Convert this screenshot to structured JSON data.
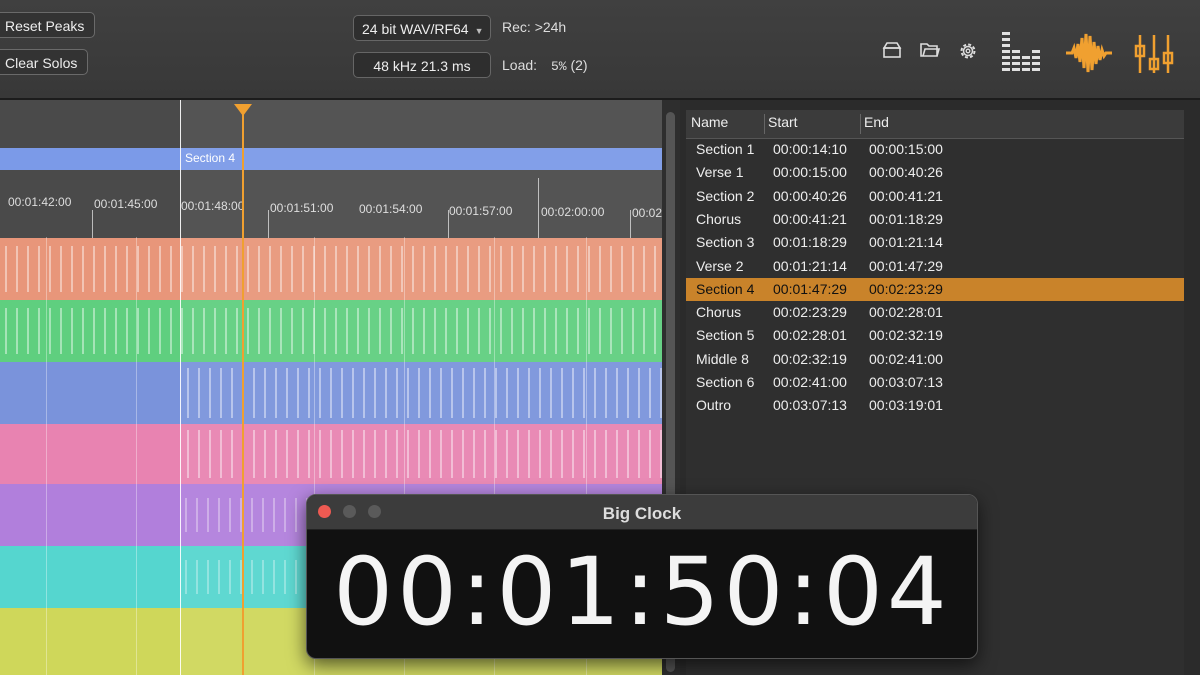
{
  "toolbar": {
    "reset_peaks": "Reset Peaks",
    "clear_solos": "Clear Solos",
    "format": "24 bit WAV/RF64",
    "rate": "48 kHz 21.3 ms",
    "rec_label": "Rec:",
    "rec_value": ">24h",
    "load_label": "Load:",
    "load_pct": "5%",
    "load_count": "(2)",
    "icons": [
      "eject-icon",
      "open-folder-icon",
      "settings-gear-icon",
      "meters-icon",
      "waveform-icon",
      "mixer-faders-icon"
    ]
  },
  "timeline": {
    "section_label": "Section 4",
    "ticks": [
      "00:01:42:00",
      "00:01:45:00",
      "00:01:48:00",
      "00:01:51:00",
      "00:01:54:00",
      "00:01:57:00",
      "00:02:00:00",
      "00:02"
    ],
    "track_colors": [
      "#e8967a",
      "#5fcf7f",
      "#7a93db",
      "#e883b1",
      "#b17fdc",
      "#55d6cf",
      "#cfd75a"
    ]
  },
  "markers": {
    "headers": {
      "name": "Name",
      "start": "Start",
      "end": "End"
    },
    "rows": [
      {
        "name": "Section 1",
        "start": "00:00:14:10",
        "end": "00:00:15:00"
      },
      {
        "name": "Verse 1",
        "start": "00:00:15:00",
        "end": "00:00:40:26"
      },
      {
        "name": "Section 2",
        "start": "00:00:40:26",
        "end": "00:00:41:21"
      },
      {
        "name": "Chorus",
        "start": "00:00:41:21",
        "end": "00:01:18:29"
      },
      {
        "name": "Section 3",
        "start": "00:01:18:29",
        "end": "00:01:21:14"
      },
      {
        "name": "Verse 2",
        "start": "00:01:21:14",
        "end": "00:01:47:29"
      },
      {
        "name": "Section 4",
        "start": "00:01:47:29",
        "end": "00:02:23:29"
      },
      {
        "name": "Chorus",
        "start": "00:02:23:29",
        "end": "00:02:28:01"
      },
      {
        "name": "Section 5",
        "start": "00:02:28:01",
        "end": "00:02:32:19"
      },
      {
        "name": "Middle 8",
        "start": "00:02:32:19",
        "end": "00:02:41:00"
      },
      {
        "name": "Section 6",
        "start": "00:02:41:00",
        "end": "00:03:07:13"
      },
      {
        "name": "Outro",
        "start": "00:03:07:13",
        "end": "00:03:19:01"
      }
    ],
    "selected_index": 6,
    "highlight_color": "#c9832a"
  },
  "clock": {
    "title": "Big Clock",
    "time": "00:01:50:04"
  }
}
